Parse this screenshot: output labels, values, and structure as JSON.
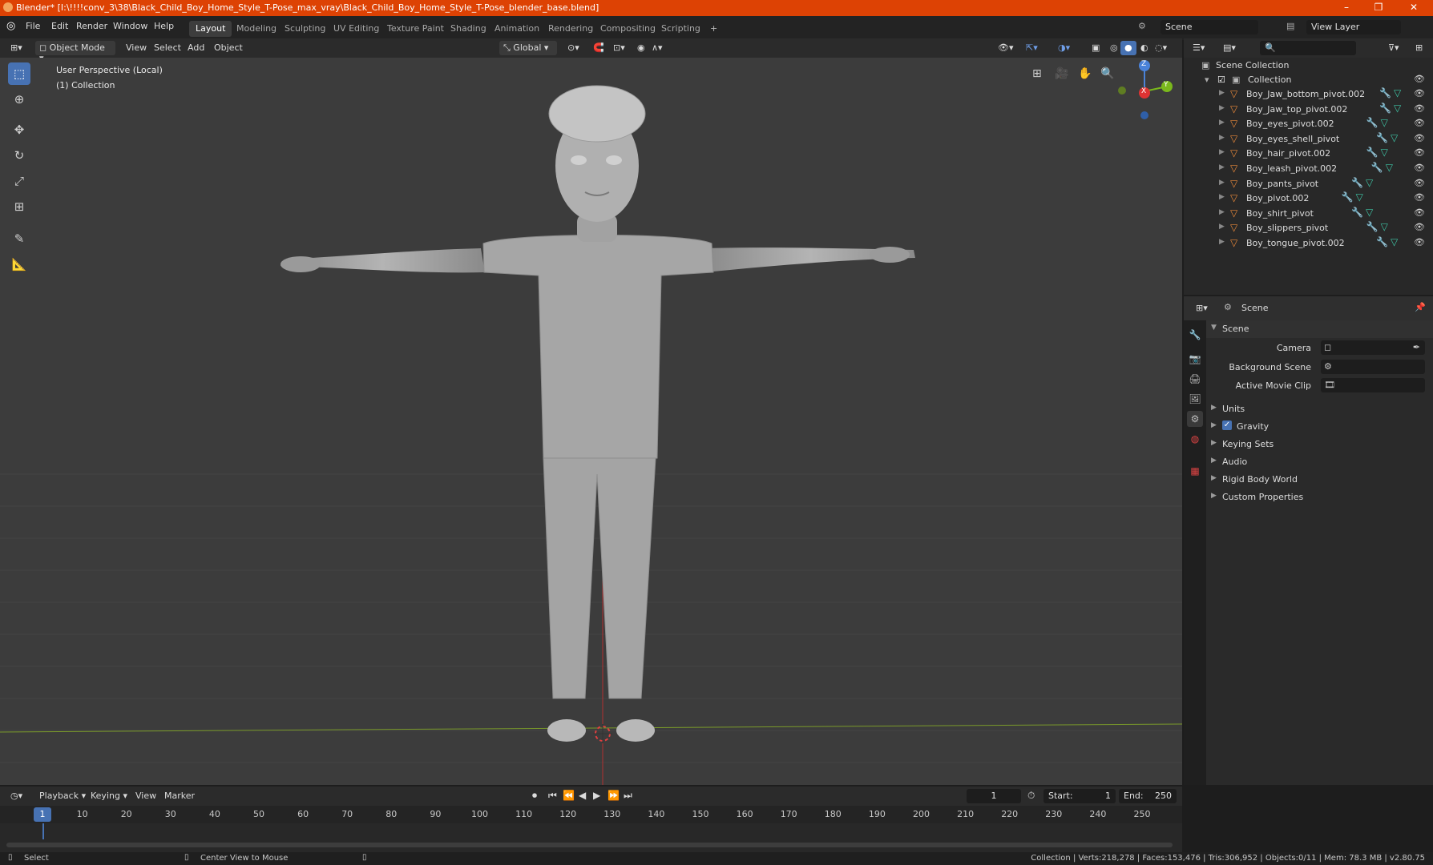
{
  "window": {
    "title": "Blender* [I:\\!!!!conv_3\\38\\Black_Child_Boy_Home_Style_T-Pose_max_vray\\Black_Child_Boy_Home_Style_T-Pose_blender_base.blend]",
    "minimize": "–",
    "maximize": "❐",
    "close": "✕"
  },
  "menu": {
    "items": [
      "File",
      "Edit",
      "Render",
      "Window",
      "Help"
    ]
  },
  "workspaces": [
    "Layout",
    "Modeling",
    "Sculpting",
    "UV Editing",
    "Texture Paint",
    "Shading",
    "Animation",
    "Rendering",
    "Compositing",
    "Scripting"
  ],
  "add_workspace": "+",
  "scene_field": "Scene",
  "view_layer_field": "View Layer",
  "viewport_header": {
    "mode": "Object Mode",
    "menus": [
      "View",
      "Select",
      "Add",
      "Object"
    ],
    "orientation": "Global"
  },
  "viewport": {
    "perspective": "User Perspective (Local)",
    "collection": "(1) Collection",
    "gizmo": {
      "z": "Z",
      "x": "X",
      "y": "Y"
    }
  },
  "outliner": {
    "root": "Scene Collection",
    "collection": "Collection",
    "objects": [
      "Boy_Jaw_bottom_pivot.002",
      "Boy_Jaw_top_pivot.002",
      "Boy_eyes_pivot.002",
      "Boy_eyes_shell_pivot",
      "Boy_hair_pivot.002",
      "Boy_leash_pivot.002",
      "Boy_pants_pivot",
      "Boy_pivot.002",
      "Boy_shirt_pivot",
      "Boy_slippers_pivot",
      "Boy_tongue_pivot.002"
    ]
  },
  "properties": {
    "context": "Scene",
    "panel_title": "Scene",
    "camera_label": "Camera",
    "background_scene_label": "Background Scene",
    "active_movie_clip_label": "Active Movie Clip",
    "subpanels": [
      "Units",
      "Gravity",
      "Keying Sets",
      "Audio",
      "Rigid Body World",
      "Custom Properties"
    ],
    "gravity_checked": true
  },
  "timeline": {
    "menus": [
      "Playback",
      "Keying",
      "View",
      "Marker"
    ],
    "current_frame": "1",
    "start_label": "Start:",
    "start_value": "1",
    "end_label": "End:",
    "end_value": "250",
    "ticks": [
      "10",
      "20",
      "30",
      "40",
      "50",
      "60",
      "70",
      "80",
      "90",
      "100",
      "110",
      "120",
      "130",
      "140",
      "150",
      "160",
      "170",
      "180",
      "190",
      "200",
      "210",
      "220",
      "230",
      "240",
      "250"
    ],
    "playhead": "1"
  },
  "statusbar": {
    "select": "Select",
    "center_view": "Center View to Mouse",
    "stats": "Collection | Verts:218,278 | Faces:153,476 | Tris:306,952 | Objects:0/11 | Mem: 78.3 MB | v2.80.75"
  }
}
